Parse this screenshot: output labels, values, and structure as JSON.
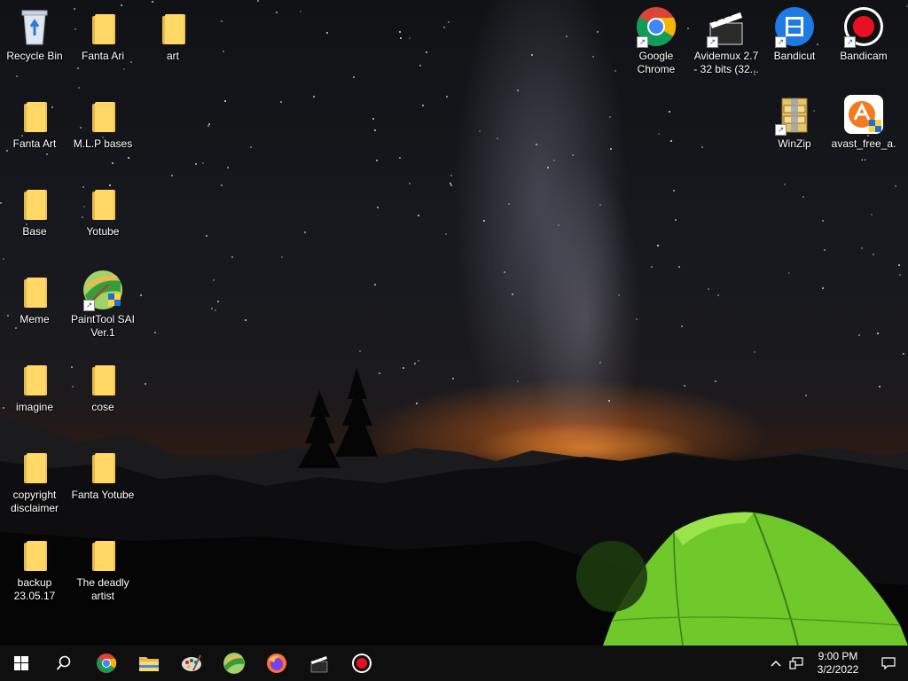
{
  "desktop": {
    "icons": [
      {
        "id": "recycle-bin",
        "label": "Recycle Bin",
        "icon": "recycle-bin-icon"
      },
      {
        "id": "fanta-ari",
        "label": "Fanta Ari",
        "icon": "folder-icon"
      },
      {
        "id": "art",
        "label": "art",
        "icon": "folder-icon"
      },
      {
        "id": "fanta-art",
        "label": "Fanta Art",
        "icon": "folder-icon"
      },
      {
        "id": "mlp-bases",
        "label": "M.L.P bases",
        "icon": "folder-icon"
      },
      {
        "id": "base",
        "label": "Base",
        "icon": "folder-icon"
      },
      {
        "id": "yotube",
        "label": "Yotube",
        "icon": "folder-icon"
      },
      {
        "id": "meme",
        "label": "Meme",
        "icon": "folder-icon"
      },
      {
        "id": "painttool-sai",
        "label": "PaintTool SAI Ver.1",
        "icon": "painttool-sai-icon"
      },
      {
        "id": "imagine",
        "label": "imagine",
        "icon": "folder-icon"
      },
      {
        "id": "cose",
        "label": "cose",
        "icon": "folder-icon"
      },
      {
        "id": "copyright-disclaimer",
        "label": "copyright disclaimer",
        "icon": "folder-icon"
      },
      {
        "id": "fanta-yotube",
        "label": "Fanta Yotube",
        "icon": "folder-icon"
      },
      {
        "id": "backup",
        "label": "backup 23.05.17",
        "icon": "folder-icon"
      },
      {
        "id": "the-deadly-artist",
        "label": "The deadly artist",
        "icon": "folder-icon"
      },
      {
        "id": "google-chrome",
        "label": "Google Chrome",
        "icon": "chrome-icon"
      },
      {
        "id": "avidemux",
        "label": "Avidemux 2.7 - 32 bits (32...",
        "icon": "clapperboard-icon"
      },
      {
        "id": "bandicut",
        "label": "Bandicut",
        "icon": "bandicut-icon"
      },
      {
        "id": "bandicam",
        "label": "Bandicam",
        "icon": "bandicam-icon"
      },
      {
        "id": "winzip",
        "label": "WinZip",
        "icon": "winzip-icon"
      },
      {
        "id": "avast",
        "label": "avast_free_a...",
        "icon": "avast-icon"
      }
    ]
  },
  "taskbar": {
    "items": [
      {
        "name": "start",
        "icon": "windows-icon"
      },
      {
        "name": "search",
        "icon": "search-icon"
      },
      {
        "name": "chrome",
        "icon": "chrome-icon"
      },
      {
        "name": "file-explorer",
        "icon": "folder-icon"
      },
      {
        "name": "paint",
        "icon": "palette-icon"
      },
      {
        "name": "painttool-sai",
        "icon": "painttool-sai-icon"
      },
      {
        "name": "firefox",
        "icon": "firefox-icon"
      },
      {
        "name": "avidemux",
        "icon": "clapperboard-icon"
      },
      {
        "name": "bandicam",
        "icon": "record-icon"
      }
    ],
    "tray": {
      "time": "9:00 PM",
      "date": "3/2/2022"
    }
  }
}
